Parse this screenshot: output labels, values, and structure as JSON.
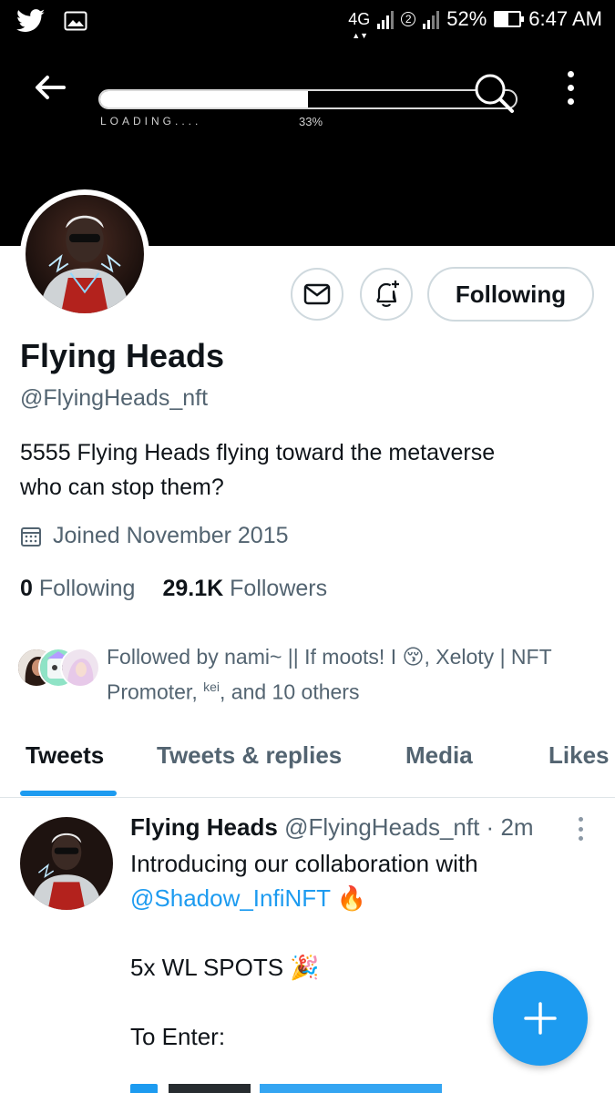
{
  "status_bar": {
    "network": "4G",
    "sim2_label": "2",
    "battery": "52%",
    "battery_level": 0.52,
    "time": "6:47 AM",
    "icons": [
      "twitter-icon",
      "image-icon",
      "signal-icon",
      "battery-icon"
    ]
  },
  "banner": {
    "loading_label": "LOADING....",
    "progress_label": "33%",
    "progress_value": 0.5,
    "colors": {
      "background": "#000000",
      "bar": "#ffffff"
    }
  },
  "profile": {
    "name": "Flying Heads",
    "handle": "@FlyingHeads_nft",
    "bio_line1": "5555 Flying Heads flying toward the metaverse",
    "bio_line2": "who can stop them?",
    "joined": "Joined November 2015",
    "following_count": "0",
    "following_label": "Following",
    "followers_count": "29.1K",
    "followers_label": "Followers",
    "follow_button": "Following",
    "followed_by_line1": "Followed by nami~ || If moots! I 😚, Xeloty | NFT",
    "followed_by_line2_a": "Promoter, ",
    "followed_by_sup": "kei",
    "followed_by_line2_b": ", and 10 others"
  },
  "tabs": [
    {
      "label": "Tweets",
      "active": true
    },
    {
      "label": "Tweets & replies",
      "active": false
    },
    {
      "label": "Media",
      "active": false
    },
    {
      "label": "Likes",
      "active": false
    }
  ],
  "tweet": {
    "author": "Flying Heads",
    "meta": "@FlyingHeads_nft · 2m",
    "line1": "Introducing our collaboration with",
    "mention": "@Shadow_InfiNFT",
    "mention_emoji": "🔥",
    "line2": "5x WL SPOTS",
    "line2_emoji": "🎉",
    "line3": "To Enter:"
  },
  "colors": {
    "accent": "#1d9bf0",
    "text_primary": "#0f1419",
    "text_secondary": "#536471",
    "border": "#cfd9de"
  }
}
